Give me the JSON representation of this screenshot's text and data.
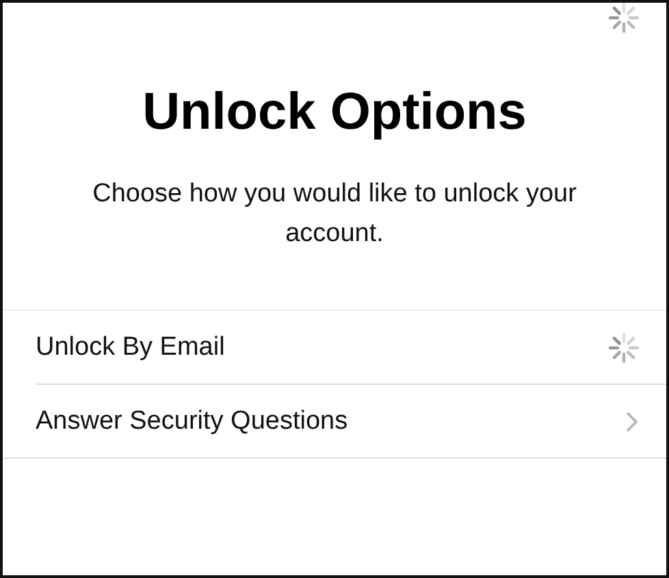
{
  "loading": true,
  "title": "Unlock Options",
  "subtitle": "Choose how you would like to unlock your account.",
  "options": [
    {
      "label": "Unlock By Email",
      "kind": "loading"
    },
    {
      "label": "Answer Security Questions",
      "kind": "link"
    }
  ]
}
